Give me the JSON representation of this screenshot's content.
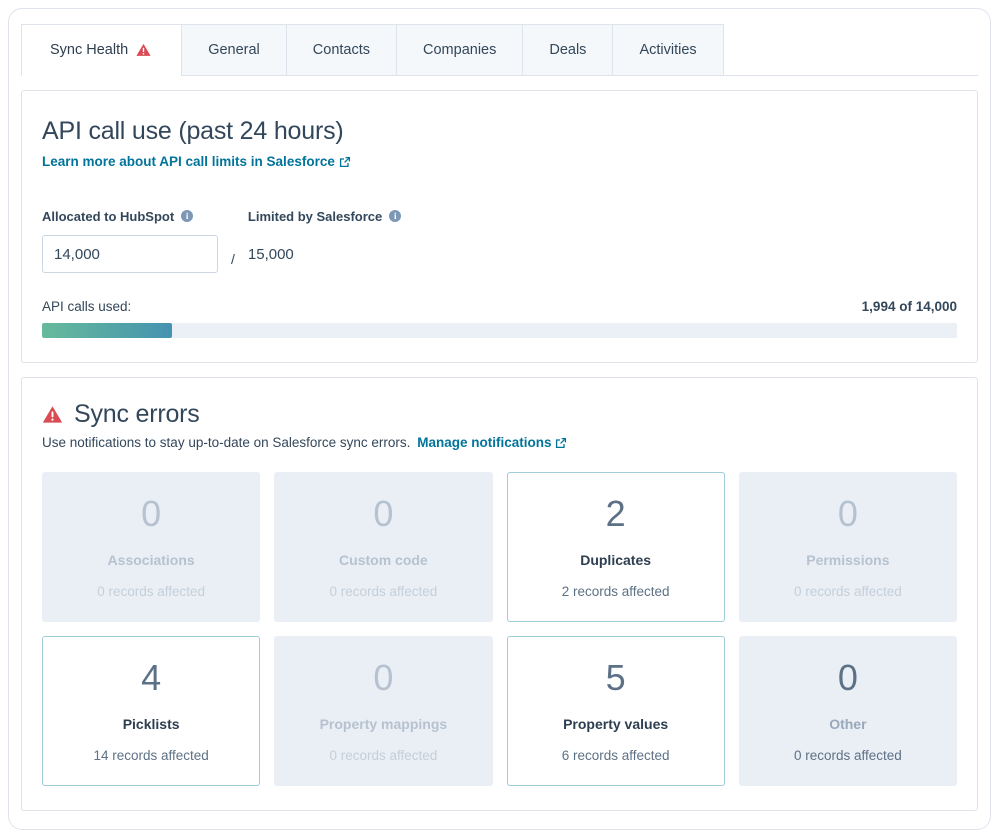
{
  "tabs": [
    {
      "label": "Sync Health",
      "active": true,
      "has_warning": true
    },
    {
      "label": "General",
      "active": false,
      "has_warning": false
    },
    {
      "label": "Contacts",
      "active": false,
      "has_warning": false
    },
    {
      "label": "Companies",
      "active": false,
      "has_warning": false
    },
    {
      "label": "Deals",
      "active": false,
      "has_warning": false
    },
    {
      "label": "Activities",
      "active": false,
      "has_warning": false
    }
  ],
  "api_section": {
    "title": "API call use (past 24 hours)",
    "learn_more_link": "Learn more about API call limits in Salesforce",
    "allocated_label": "Allocated to HubSpot",
    "allocated_value": "14,000",
    "separator": "/",
    "limited_label": "Limited by Salesforce",
    "limited_value": "15,000",
    "usage_label": "API calls used:",
    "usage_count": "1,994 of 14,000",
    "progress_percent": 14.2,
    "bar_gradient_start": "#68ba9c",
    "bar_gradient_end": "#4592b1",
    "bar_track_color": "#eaf0f6"
  },
  "sync_errors": {
    "title": "Sync errors",
    "description": "Use notifications to stay up-to-date on Salesforce sync errors.",
    "manage_link": "Manage notifications",
    "warning_color": "#d94c53",
    "active_border_color": "#9fcdd8",
    "cards": [
      {
        "count": "0",
        "name": "Associations",
        "records": "0 records affected",
        "state": "muted"
      },
      {
        "count": "0",
        "name": "Custom code",
        "records": "0 records affected",
        "state": "muted"
      },
      {
        "count": "2",
        "name": "Duplicates",
        "records": "2 records affected",
        "state": "active"
      },
      {
        "count": "0",
        "name": "Permissions",
        "records": "0 records affected",
        "state": "muted"
      },
      {
        "count": "4",
        "name": "Picklists",
        "records": "14 records affected",
        "state": "active"
      },
      {
        "count": "0",
        "name": "Property mappings",
        "records": "0 records affected",
        "state": "muted"
      },
      {
        "count": "5",
        "name": "Property values",
        "records": "6 records affected",
        "state": "active"
      },
      {
        "count": "0",
        "name": "Other",
        "records": "0 records affected",
        "state": "dim"
      }
    ]
  }
}
